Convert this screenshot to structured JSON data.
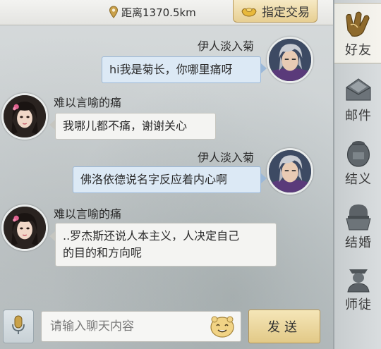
{
  "topbar": {
    "pin_icon": "location-pin-icon",
    "distance_label": "距离1370.5km",
    "trade_icon": "gold-ingot-icon",
    "trade_label": "指定交易"
  },
  "sidebar": {
    "items": [
      {
        "label": "好友",
        "icon": "friends-handshake-icon",
        "active": true
      },
      {
        "label": "邮件",
        "icon": "envelope-icon",
        "active": false
      },
      {
        "label": "结义",
        "icon": "wine-jar-icon",
        "active": false
      },
      {
        "label": "结婚",
        "icon": "marriage-icon",
        "active": false
      },
      {
        "label": "师徒",
        "icon": "master-apprentice-icon",
        "active": false
      }
    ]
  },
  "messages": [
    {
      "sender": "伊人淡入菊",
      "side": "out",
      "text": "hi我是菊长，你哪里痛呀"
    },
    {
      "sender": "难以言喻的痛",
      "side": "in",
      "text": "我哪儿都不痛，谢谢关心"
    },
    {
      "sender": "伊人淡入菊",
      "side": "out",
      "text": "佛洛依德说名字反应着内心啊"
    },
    {
      "sender": "难以言喻的痛",
      "side": "in",
      "text_line1": "..罗杰斯还说人本主义，人决定自己",
      "text_line2": "的目的和方向呢"
    }
  ],
  "input": {
    "mic_icon": "microphone-icon",
    "placeholder": "请输入聊天内容",
    "emoji_icon": "smiley-face-icon",
    "send_label": "发送"
  },
  "colors": {
    "outgoing_bubble": "#dce9f5",
    "incoming_bubble": "#f4f4f2",
    "gold_button": "#e7cf93"
  }
}
